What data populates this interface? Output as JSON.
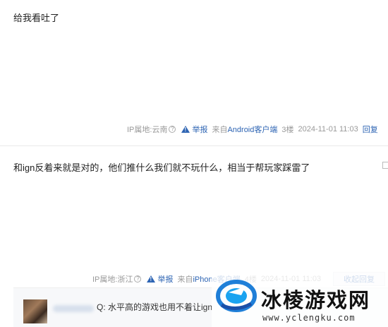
{
  "posts": [
    {
      "content": "给我看吐了",
      "meta": {
        "ip": "IP属地:云南",
        "report": "举报",
        "client": "来自Android客户端",
        "floor": "3楼",
        "time": "2024-11-01 11:03",
        "reply": "回复"
      }
    },
    {
      "content": "和ign反着来就是对的，他们推什么我们就不玩什么，相当于帮玩家踩雷了",
      "meta": {
        "ip": "IP属地:浙江",
        "report": "举报",
        "client": "来自iPhone客户端",
        "floor": "4楼",
        "time": "2024-11-01 11:03",
        "collapse": "收起回复"
      },
      "sub_reply": {
        "text": "Q: 水平高的游戏也用不着让ign"
      }
    }
  ],
  "watermark": {
    "title": "冰棱游戏网",
    "url": "www.yclengku.com"
  },
  "icons": {
    "help": "question-circle-icon",
    "report": "warning-triangle-icon"
  },
  "colors": {
    "link": "#2d64b3",
    "meta": "#999999"
  }
}
